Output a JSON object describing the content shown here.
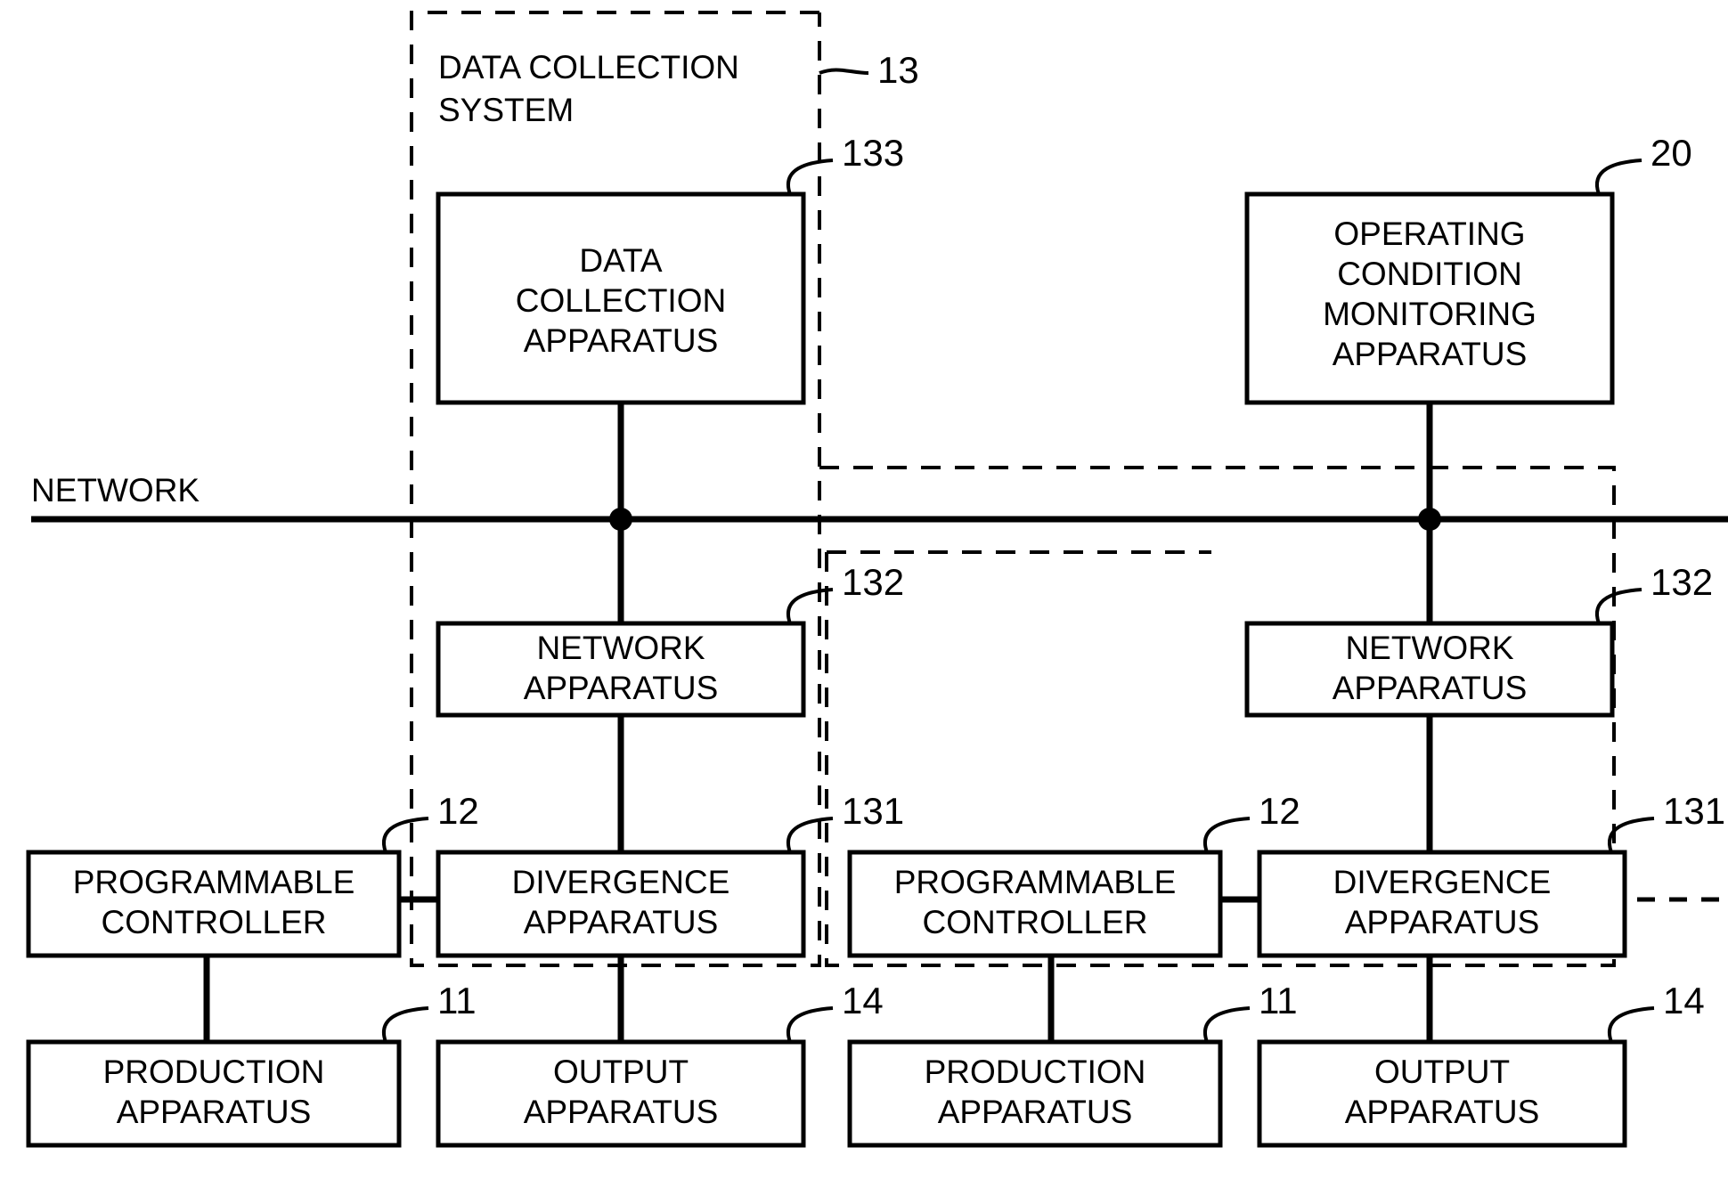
{
  "diagram": {
    "network_bus_label": "NETWORK",
    "regions": [
      {
        "id": "data-collection-system",
        "title_line1": "DATA COLLECTION",
        "title_line2": "SYSTEM",
        "ref": "13"
      },
      {
        "id": "region-middle",
        "ref": ""
      },
      {
        "id": "region-right",
        "ref": ""
      }
    ],
    "boxes": {
      "data_collection_apparatus": {
        "lines": [
          "DATA",
          "COLLECTION",
          "APPARATUS"
        ],
        "ref": "133"
      },
      "operating_condition_monitoring_apparatus": {
        "lines": [
          "OPERATING",
          "CONDITION",
          "MONITORING",
          "APPARATUS"
        ],
        "ref": "20"
      },
      "network_apparatus_left": {
        "lines": [
          "NETWORK",
          "APPARATUS"
        ],
        "ref": "132"
      },
      "network_apparatus_right": {
        "lines": [
          "NETWORK",
          "APPARATUS"
        ],
        "ref": "132"
      },
      "divergence_apparatus_left": {
        "lines": [
          "DIVERGENCE",
          "APPARATUS"
        ],
        "ref": "131"
      },
      "divergence_apparatus_right": {
        "lines": [
          "DIVERGENCE",
          "APPARATUS"
        ],
        "ref": "131"
      },
      "programmable_controller_left": {
        "lines": [
          "PROGRAMMABLE",
          "CONTROLLER"
        ],
        "ref": "12"
      },
      "programmable_controller_right": {
        "lines": [
          "PROGRAMMABLE",
          "CONTROLLER"
        ],
        "ref": "12"
      },
      "production_apparatus_left": {
        "lines": [
          "PRODUCTION",
          "APPARATUS"
        ],
        "ref": "11"
      },
      "production_apparatus_right": {
        "lines": [
          "PRODUCTION",
          "APPARATUS"
        ],
        "ref": "11"
      },
      "output_apparatus_left": {
        "lines": [
          "OUTPUT",
          "APPARATUS"
        ],
        "ref": "14"
      },
      "output_apparatus_right": {
        "lines": [
          "OUTPUT",
          "APPARATUS"
        ],
        "ref": "14"
      }
    },
    "colors": {
      "stroke": "#000000",
      "background": "#ffffff"
    }
  }
}
